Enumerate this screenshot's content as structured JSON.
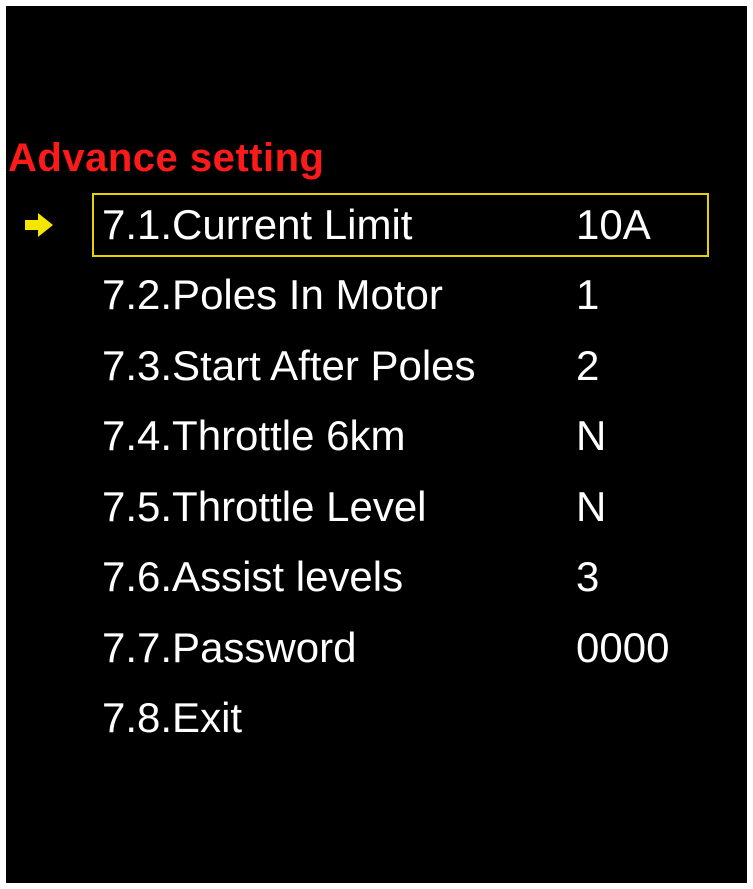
{
  "screen": {
    "title": "Advance setting",
    "title_color": "#ff1a1a",
    "background": "#000000",
    "text_color": "#ffffff",
    "selection_color": "#e6d200",
    "cursor_icon": "arrow-right-icon",
    "selected_index": 0
  },
  "menu": {
    "items": [
      {
        "label": "7.1.Current Limit",
        "value": "10A"
      },
      {
        "label": "7.2.Poles In Motor",
        "value": "1"
      },
      {
        "label": "7.3.Start After Poles",
        "value": "2"
      },
      {
        "label": "7.4.Throttle 6km",
        "value": "N"
      },
      {
        "label": "7.5.Throttle Level",
        "value": "N"
      },
      {
        "label": "7.6.Assist levels",
        "value": "3"
      },
      {
        "label": "7.7.Password",
        "value": "0000"
      },
      {
        "label": "7.8.Exit",
        "value": ""
      }
    ]
  }
}
